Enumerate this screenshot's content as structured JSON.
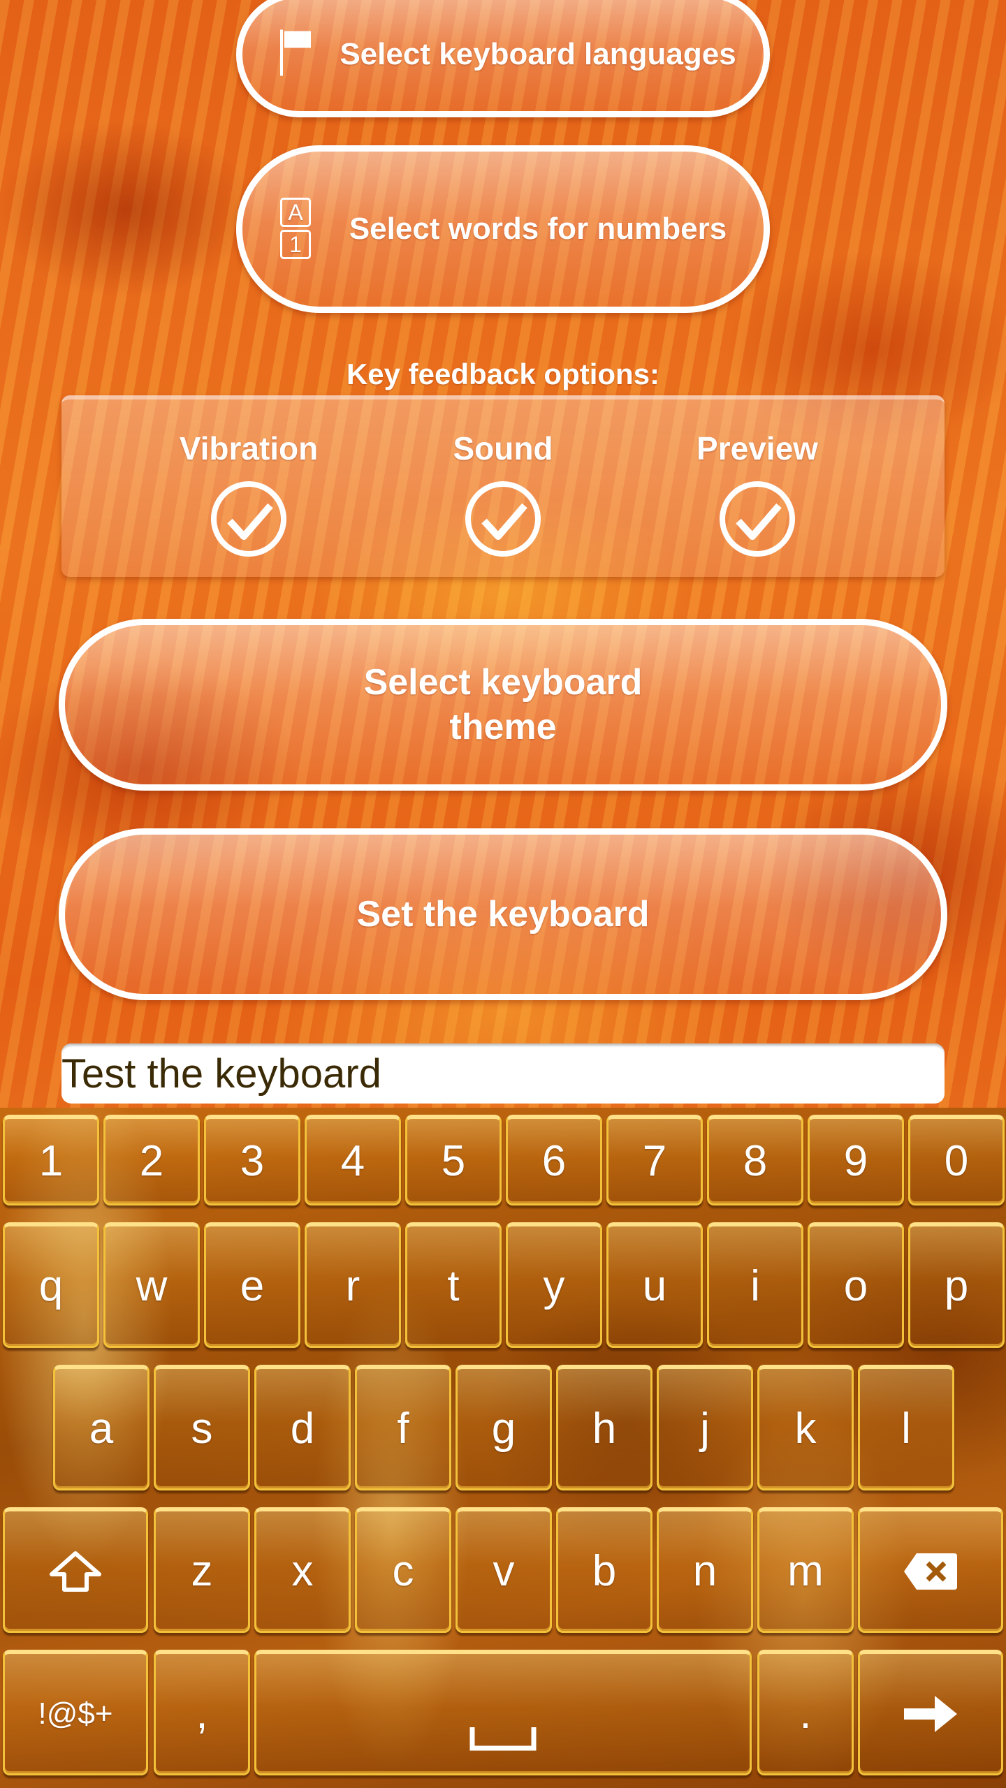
{
  "menu": {
    "languages_label": "Select keyboard languages",
    "numbers_label": "Select words for numbers",
    "numbers_icon_top": "A",
    "numbers_icon_bottom": "1",
    "theme_label_line1": "Select keyboard",
    "theme_label_line2": "theme",
    "set_keyboard_label": "Set the keyboard"
  },
  "feedback": {
    "heading": "Key feedback options:",
    "options": [
      {
        "label": "Vibration",
        "checked": true
      },
      {
        "label": "Sound",
        "checked": true
      },
      {
        "label": "Preview",
        "checked": true
      }
    ]
  },
  "test_input": {
    "placeholder": "Test the keyboard",
    "value": ""
  },
  "keyboard": {
    "row_numbers": [
      "1",
      "2",
      "3",
      "4",
      "5",
      "6",
      "7",
      "8",
      "9",
      "0"
    ],
    "row_top": [
      "q",
      "w",
      "e",
      "r",
      "t",
      "y",
      "u",
      "i",
      "o",
      "p"
    ],
    "row_home": [
      "a",
      "s",
      "d",
      "f",
      "g",
      "h",
      "j",
      "k",
      "l"
    ],
    "row_bottom": [
      "z",
      "x",
      "c",
      "v",
      "b",
      "n",
      "m"
    ],
    "symbols_label": "!@$+",
    "comma_label": ",",
    "period_label": ".",
    "shift_icon": "shift-arrow-up",
    "backspace_icon": "backspace-x",
    "space_icon": "space-bracket",
    "enter_icon": "arrow-right"
  },
  "colors": {
    "key_border": "#f3c23a",
    "input_text": "#3a2a05"
  }
}
